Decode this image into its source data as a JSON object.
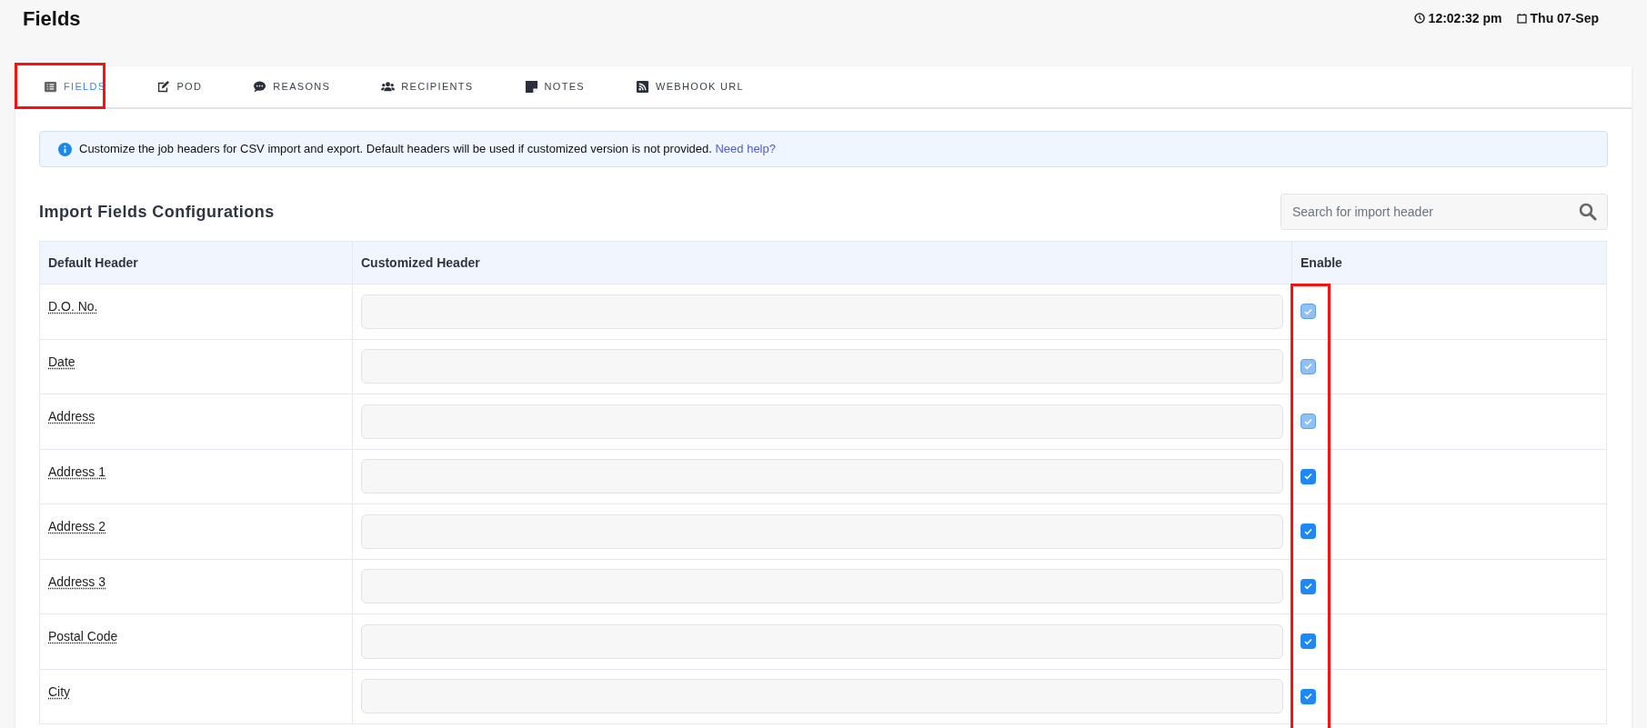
{
  "page": {
    "title": "Fields",
    "time": "12:02:32 pm",
    "date": "Thu 07-Sep"
  },
  "tabs": [
    {
      "label": "FIELDS",
      "selected": true
    },
    {
      "label": "POD",
      "selected": false
    },
    {
      "label": "REASONS",
      "selected": false
    },
    {
      "label": "RECIPIENTS",
      "selected": false
    },
    {
      "label": "NOTES",
      "selected": false
    },
    {
      "label": "WEBHOOK URL",
      "selected": false
    }
  ],
  "info": {
    "text": "Customize the job headers for CSV import and export. Default headers will be used if customized version is not provided.",
    "link": "Need help?"
  },
  "section": {
    "title": "Import Fields Configurations",
    "search": {
      "placeholder": "Search for import header"
    }
  },
  "table": {
    "columns": [
      "Default Header",
      "Customized Header",
      "Enable"
    ],
    "rows": [
      {
        "default_header": "D.O. No.",
        "checked": true,
        "disabled": true
      },
      {
        "default_header": "Date",
        "checked": true,
        "disabled": true
      },
      {
        "default_header": "Address",
        "checked": true,
        "disabled": true
      },
      {
        "default_header": "Address 1",
        "checked": true,
        "disabled": false
      },
      {
        "default_header": "Address 2",
        "checked": true,
        "disabled": false
      },
      {
        "default_header": "Address 3",
        "checked": true,
        "disabled": false
      },
      {
        "default_header": "Postal Code",
        "checked": true,
        "disabled": false
      },
      {
        "default_header": "City",
        "checked": true,
        "disabled": false
      }
    ]
  }
}
